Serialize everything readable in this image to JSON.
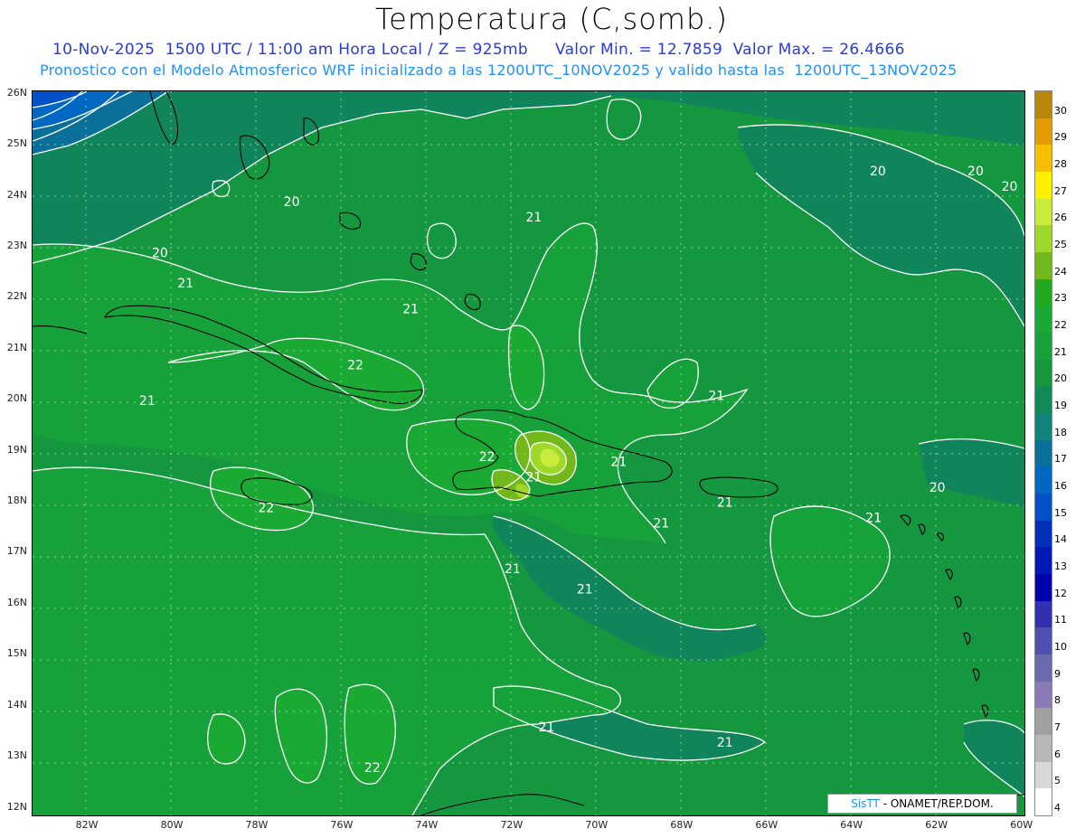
{
  "header": {
    "title": "Temperatura (C,somb.)",
    "line1": "10-Nov-2025  1500 UTC / 11:00 am Hora Local / Z = 925mb",
    "min_text": "Valor Min. = 12.7859",
    "max_text": "Valor Max. = 26.4666",
    "line2": "Pronostico con el Modelo Atmosferico WRF inicializado a las 1200UTC_10NOV2025 y valido hasta las  1200UTC_13NOV2025"
  },
  "axes": {
    "y_ticks": [
      "26N",
      "25N",
      "24N",
      "23N",
      "22N",
      "21N",
      "20N",
      "19N",
      "18N",
      "17N",
      "16N",
      "15N",
      "14N",
      "13N",
      "12N"
    ],
    "x_ticks": [
      "82W",
      "80W",
      "78W",
      "76W",
      "74W",
      "72W",
      "70W",
      "68W",
      "66W",
      "64W",
      "62W",
      "60W"
    ]
  },
  "contour_labels": [
    {
      "text": "20",
      "lon": -63.4,
      "lat": 24.4
    },
    {
      "text": "20",
      "lon": -61.1,
      "lat": 24.4
    },
    {
      "text": "20",
      "lon": -60.3,
      "lat": 24.1
    },
    {
      "text": "20",
      "lon": -80.3,
      "lat": 22.8
    },
    {
      "text": "20",
      "lon": -77.2,
      "lat": 23.8
    },
    {
      "text": "21",
      "lon": -71.5,
      "lat": 23.5
    },
    {
      "text": "21",
      "lon": -79.7,
      "lat": 22.2
    },
    {
      "text": "21",
      "lon": -74.4,
      "lat": 21.7
    },
    {
      "text": "22",
      "lon": -75.7,
      "lat": 20.6
    },
    {
      "text": "21",
      "lon": -80.6,
      "lat": 19.9
    },
    {
      "text": "21",
      "lon": -67.2,
      "lat": 20.0
    },
    {
      "text": "22",
      "lon": -72.6,
      "lat": 18.8
    },
    {
      "text": "21",
      "lon": -71.5,
      "lat": 18.4
    },
    {
      "text": "21",
      "lon": -69.5,
      "lat": 18.7
    },
    {
      "text": "22",
      "lon": -77.8,
      "lat": 17.8
    },
    {
      "text": "20",
      "lon": -62.0,
      "lat": 18.2
    },
    {
      "text": "21",
      "lon": -67.0,
      "lat": 17.9
    },
    {
      "text": "21",
      "lon": -68.5,
      "lat": 17.5
    },
    {
      "text": "21",
      "lon": -63.5,
      "lat": 17.6
    },
    {
      "text": "21",
      "lon": -72.0,
      "lat": 16.6
    },
    {
      "text": "21",
      "lon": -70.3,
      "lat": 16.2
    },
    {
      "text": "21",
      "lon": -71.2,
      "lat": 13.5
    },
    {
      "text": "21",
      "lon": -67.0,
      "lat": 13.2
    },
    {
      "text": "22",
      "lon": -75.3,
      "lat": 12.7
    }
  ],
  "legend": {
    "labels": [
      "30",
      "29",
      "28",
      "27",
      "26",
      "25",
      "24",
      "23",
      "22",
      "21",
      "20",
      "19",
      "18",
      "17",
      "16",
      "15",
      "14",
      "13",
      "12",
      "11",
      "10",
      "9",
      "8",
      "7",
      "6",
      "5",
      "4"
    ],
    "colors": [
      "#b8860b",
      "#e39b00",
      "#f7be00",
      "#fff000",
      "#c8ec3a",
      "#9ed82a",
      "#72b81a",
      "#1faa1f",
      "#1aaa33",
      "#17a13b",
      "#14973f",
      "#108a56",
      "#10847a",
      "#0a7099",
      "#0068c0",
      "#0050c8",
      "#0030b8",
      "#0018b8",
      "#0000b0",
      "#3030b0",
      "#5050b0",
      "#6a6ab0",
      "#8a7ab8",
      "#a0a0a0",
      "#b8b8b8",
      "#d8d8d8",
      "#ffffff"
    ]
  },
  "credit": {
    "sis": "SisTT",
    "rest": "- ONAMET/REP.DOM."
  }
}
